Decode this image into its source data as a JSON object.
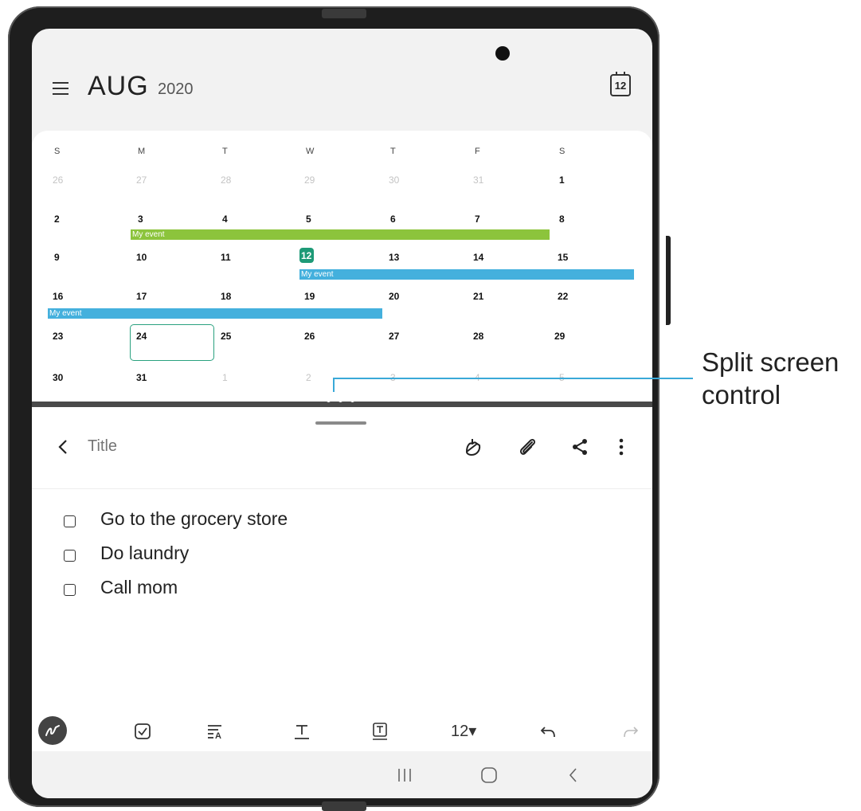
{
  "calendar": {
    "month": "AUG",
    "year": "2020",
    "today_icon_label": "12",
    "weekdays": [
      "S",
      "M",
      "T",
      "W",
      "T",
      "F",
      "S"
    ],
    "weeks": [
      [
        "26",
        "27",
        "28",
        "29",
        "30",
        "31",
        "1"
      ],
      [
        "2",
        "3",
        "4",
        "5",
        "6",
        "7",
        "8"
      ],
      [
        "9",
        "10",
        "11",
        "12",
        "13",
        "14",
        "15"
      ],
      [
        "16",
        "17",
        "18",
        "19",
        "20",
        "21",
        "22"
      ],
      [
        "23",
        "24",
        "25",
        "26",
        "27",
        "28",
        "29"
      ],
      [
        "30",
        "31",
        "1",
        "2",
        "3",
        "4",
        "5"
      ]
    ],
    "events": [
      {
        "label": "My event",
        "color": "#8cc43c"
      },
      {
        "label": "My event",
        "color": "#44b0dd"
      },
      {
        "label": "My event",
        "color": "#44b0dd"
      }
    ],
    "today_color": "#1e9a77",
    "fab_color": "#21a47b"
  },
  "notes": {
    "title_placeholder": "Title",
    "toolbar_icons": [
      "handwriting-icon",
      "attach-icon",
      "share-icon",
      "more-icon"
    ],
    "checklist": [
      {
        "text": "Go to the grocery store",
        "checked": false
      },
      {
        "text": "Do laundry",
        "checked": false
      },
      {
        "text": "Call mom",
        "checked": false
      }
    ],
    "format_bar": {
      "icons": [
        "pen-icon",
        "checkbox-icon",
        "text-style-icon",
        "underline-text-icon",
        "text-box-icon",
        "undo-icon",
        "redo-icon"
      ],
      "font_size": "12▾"
    }
  },
  "navbar": {
    "icons": [
      "recent-apps-icon",
      "home-icon",
      "back-icon"
    ]
  },
  "callout": {
    "line1": "Split screen",
    "line2": "control",
    "color": "#3aa9d8"
  }
}
